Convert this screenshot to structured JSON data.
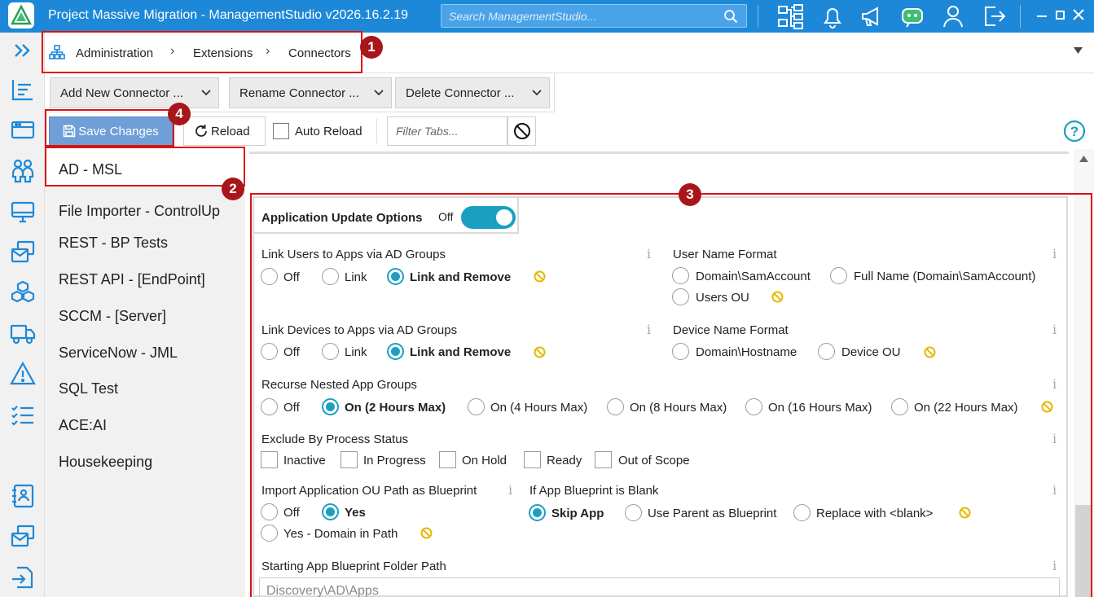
{
  "titlebar": {
    "title": "Project Massive Migration - ManagementStudio v2026.16.2.19",
    "search_placeholder": "Search ManagementStudio...",
    "icons": [
      "tree-icon",
      "bell-icon",
      "megaphone-icon",
      "chatbot-icon",
      "user-icon",
      "logout-icon",
      "minimize-icon",
      "maximize-icon",
      "close-icon"
    ]
  },
  "breadcrumb": {
    "items": [
      "Administration",
      "Extensions",
      "Connectors"
    ]
  },
  "toolbar": {
    "add_connector": "Add New Connector ...",
    "rename_connector": "Rename Connector ...",
    "delete_connector": "Delete Connector ...",
    "save_changes": "Save Changes",
    "reload": "Reload",
    "auto_reload": "Auto Reload",
    "filter_placeholder": "Filter Tabs..."
  },
  "connectors": [
    "AD - MSL",
    "File Importer - ControlUp",
    "REST - BP Tests",
    "REST API - [EndPoint]",
    "SCCM - [Server]",
    "ServiceNow - JML",
    "SQL Test",
    "ACE:AI",
    "Housekeeping"
  ],
  "selected_connector": "AD - MSL",
  "panel": {
    "tab_title": "Application Update Options",
    "toggle_label": "Off",
    "toggle_color": "#1a9fc2",
    "link_users": {
      "label": "Link Users to Apps via AD Groups",
      "options": [
        "Off",
        "Link",
        "Link and Remove"
      ],
      "selected": "Link and Remove"
    },
    "user_name_format": {
      "label": "User Name Format",
      "options": [
        "Domain\\SamAccount",
        "Full Name (Domain\\SamAccount)",
        "Users OU"
      ]
    },
    "link_devices": {
      "label": "Link Devices to Apps via AD Groups",
      "options": [
        "Off",
        "Link",
        "Link and Remove"
      ],
      "selected": "Link and Remove"
    },
    "device_name_format": {
      "label": "Device Name Format",
      "options": [
        "Domain\\Hostname",
        "Device OU"
      ]
    },
    "recurse": {
      "label": "Recurse Nested App Groups",
      "options": [
        "Off",
        "On (2 Hours Max)",
        "On (4 Hours Max)",
        "On (8 Hours Max)",
        "On (16 Hours Max)",
        "On (22 Hours Max)"
      ],
      "selected": "On (2 Hours Max)"
    },
    "exclude": {
      "label": "Exclude By Process Status",
      "options": [
        "Inactive",
        "In Progress",
        "On Hold",
        "Ready",
        "Out of Scope"
      ]
    },
    "import_ou": {
      "label": "Import Application OU Path as Blueprint",
      "options": [
        "Off",
        "Yes",
        "Yes - Domain in Path"
      ],
      "selected": "Yes"
    },
    "blueprint_blank": {
      "label": "If App Blueprint is Blank",
      "options": [
        "Skip App",
        "Use Parent as Blueprint",
        "Replace with <blank>"
      ],
      "selected": "Skip App"
    },
    "starting_path": {
      "label": "Starting App Blueprint Folder Path",
      "value": "Discovery\\AD\\Apps"
    },
    "info_glyph": "i"
  },
  "callouts": [
    "1",
    "2",
    "3",
    "4"
  ],
  "colors": {
    "titlebar": "#1e88d8",
    "accent": "#1a9fc2",
    "callout": "#a8161b",
    "warn": "#e6b800"
  }
}
